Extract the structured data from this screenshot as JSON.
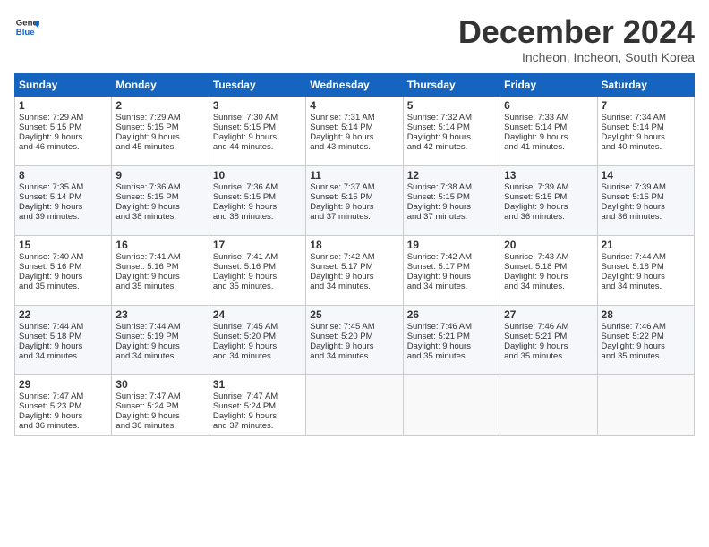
{
  "logo": {
    "line1": "General",
    "line2": "Blue"
  },
  "title": "December 2024",
  "subtitle": "Incheon, Incheon, South Korea",
  "headers": [
    "Sunday",
    "Monday",
    "Tuesday",
    "Wednesday",
    "Thursday",
    "Friday",
    "Saturday"
  ],
  "weeks": [
    [
      {
        "day": "1",
        "lines": [
          "Sunrise: 7:29 AM",
          "Sunset: 5:15 PM",
          "Daylight: 9 hours",
          "and 46 minutes."
        ]
      },
      {
        "day": "2",
        "lines": [
          "Sunrise: 7:29 AM",
          "Sunset: 5:15 PM",
          "Daylight: 9 hours",
          "and 45 minutes."
        ]
      },
      {
        "day": "3",
        "lines": [
          "Sunrise: 7:30 AM",
          "Sunset: 5:15 PM",
          "Daylight: 9 hours",
          "and 44 minutes."
        ]
      },
      {
        "day": "4",
        "lines": [
          "Sunrise: 7:31 AM",
          "Sunset: 5:14 PM",
          "Daylight: 9 hours",
          "and 43 minutes."
        ]
      },
      {
        "day": "5",
        "lines": [
          "Sunrise: 7:32 AM",
          "Sunset: 5:14 PM",
          "Daylight: 9 hours",
          "and 42 minutes."
        ]
      },
      {
        "day": "6",
        "lines": [
          "Sunrise: 7:33 AM",
          "Sunset: 5:14 PM",
          "Daylight: 9 hours",
          "and 41 minutes."
        ]
      },
      {
        "day": "7",
        "lines": [
          "Sunrise: 7:34 AM",
          "Sunset: 5:14 PM",
          "Daylight: 9 hours",
          "and 40 minutes."
        ]
      }
    ],
    [
      {
        "day": "8",
        "lines": [
          "Sunrise: 7:35 AM",
          "Sunset: 5:14 PM",
          "Daylight: 9 hours",
          "and 39 minutes."
        ]
      },
      {
        "day": "9",
        "lines": [
          "Sunrise: 7:36 AM",
          "Sunset: 5:15 PM",
          "Daylight: 9 hours",
          "and 38 minutes."
        ]
      },
      {
        "day": "10",
        "lines": [
          "Sunrise: 7:36 AM",
          "Sunset: 5:15 PM",
          "Daylight: 9 hours",
          "and 38 minutes."
        ]
      },
      {
        "day": "11",
        "lines": [
          "Sunrise: 7:37 AM",
          "Sunset: 5:15 PM",
          "Daylight: 9 hours",
          "and 37 minutes."
        ]
      },
      {
        "day": "12",
        "lines": [
          "Sunrise: 7:38 AM",
          "Sunset: 5:15 PM",
          "Daylight: 9 hours",
          "and 37 minutes."
        ]
      },
      {
        "day": "13",
        "lines": [
          "Sunrise: 7:39 AM",
          "Sunset: 5:15 PM",
          "Daylight: 9 hours",
          "and 36 minutes."
        ]
      },
      {
        "day": "14",
        "lines": [
          "Sunrise: 7:39 AM",
          "Sunset: 5:15 PM",
          "Daylight: 9 hours",
          "and 36 minutes."
        ]
      }
    ],
    [
      {
        "day": "15",
        "lines": [
          "Sunrise: 7:40 AM",
          "Sunset: 5:16 PM",
          "Daylight: 9 hours",
          "and 35 minutes."
        ]
      },
      {
        "day": "16",
        "lines": [
          "Sunrise: 7:41 AM",
          "Sunset: 5:16 PM",
          "Daylight: 9 hours",
          "and 35 minutes."
        ]
      },
      {
        "day": "17",
        "lines": [
          "Sunrise: 7:41 AM",
          "Sunset: 5:16 PM",
          "Daylight: 9 hours",
          "and 35 minutes."
        ]
      },
      {
        "day": "18",
        "lines": [
          "Sunrise: 7:42 AM",
          "Sunset: 5:17 PM",
          "Daylight: 9 hours",
          "and 34 minutes."
        ]
      },
      {
        "day": "19",
        "lines": [
          "Sunrise: 7:42 AM",
          "Sunset: 5:17 PM",
          "Daylight: 9 hours",
          "and 34 minutes."
        ]
      },
      {
        "day": "20",
        "lines": [
          "Sunrise: 7:43 AM",
          "Sunset: 5:18 PM",
          "Daylight: 9 hours",
          "and 34 minutes."
        ]
      },
      {
        "day": "21",
        "lines": [
          "Sunrise: 7:44 AM",
          "Sunset: 5:18 PM",
          "Daylight: 9 hours",
          "and 34 minutes."
        ]
      }
    ],
    [
      {
        "day": "22",
        "lines": [
          "Sunrise: 7:44 AM",
          "Sunset: 5:18 PM",
          "Daylight: 9 hours",
          "and 34 minutes."
        ]
      },
      {
        "day": "23",
        "lines": [
          "Sunrise: 7:44 AM",
          "Sunset: 5:19 PM",
          "Daylight: 9 hours",
          "and 34 minutes."
        ]
      },
      {
        "day": "24",
        "lines": [
          "Sunrise: 7:45 AM",
          "Sunset: 5:20 PM",
          "Daylight: 9 hours",
          "and 34 minutes."
        ]
      },
      {
        "day": "25",
        "lines": [
          "Sunrise: 7:45 AM",
          "Sunset: 5:20 PM",
          "Daylight: 9 hours",
          "and 34 minutes."
        ]
      },
      {
        "day": "26",
        "lines": [
          "Sunrise: 7:46 AM",
          "Sunset: 5:21 PM",
          "Daylight: 9 hours",
          "and 35 minutes."
        ]
      },
      {
        "day": "27",
        "lines": [
          "Sunrise: 7:46 AM",
          "Sunset: 5:21 PM",
          "Daylight: 9 hours",
          "and 35 minutes."
        ]
      },
      {
        "day": "28",
        "lines": [
          "Sunrise: 7:46 AM",
          "Sunset: 5:22 PM",
          "Daylight: 9 hours",
          "and 35 minutes."
        ]
      }
    ],
    [
      {
        "day": "29",
        "lines": [
          "Sunrise: 7:47 AM",
          "Sunset: 5:23 PM",
          "Daylight: 9 hours",
          "and 36 minutes."
        ]
      },
      {
        "day": "30",
        "lines": [
          "Sunrise: 7:47 AM",
          "Sunset: 5:24 PM",
          "Daylight: 9 hours",
          "and 36 minutes."
        ]
      },
      {
        "day": "31",
        "lines": [
          "Sunrise: 7:47 AM",
          "Sunset: 5:24 PM",
          "Daylight: 9 hours",
          "and 37 minutes."
        ]
      },
      null,
      null,
      null,
      null
    ]
  ]
}
